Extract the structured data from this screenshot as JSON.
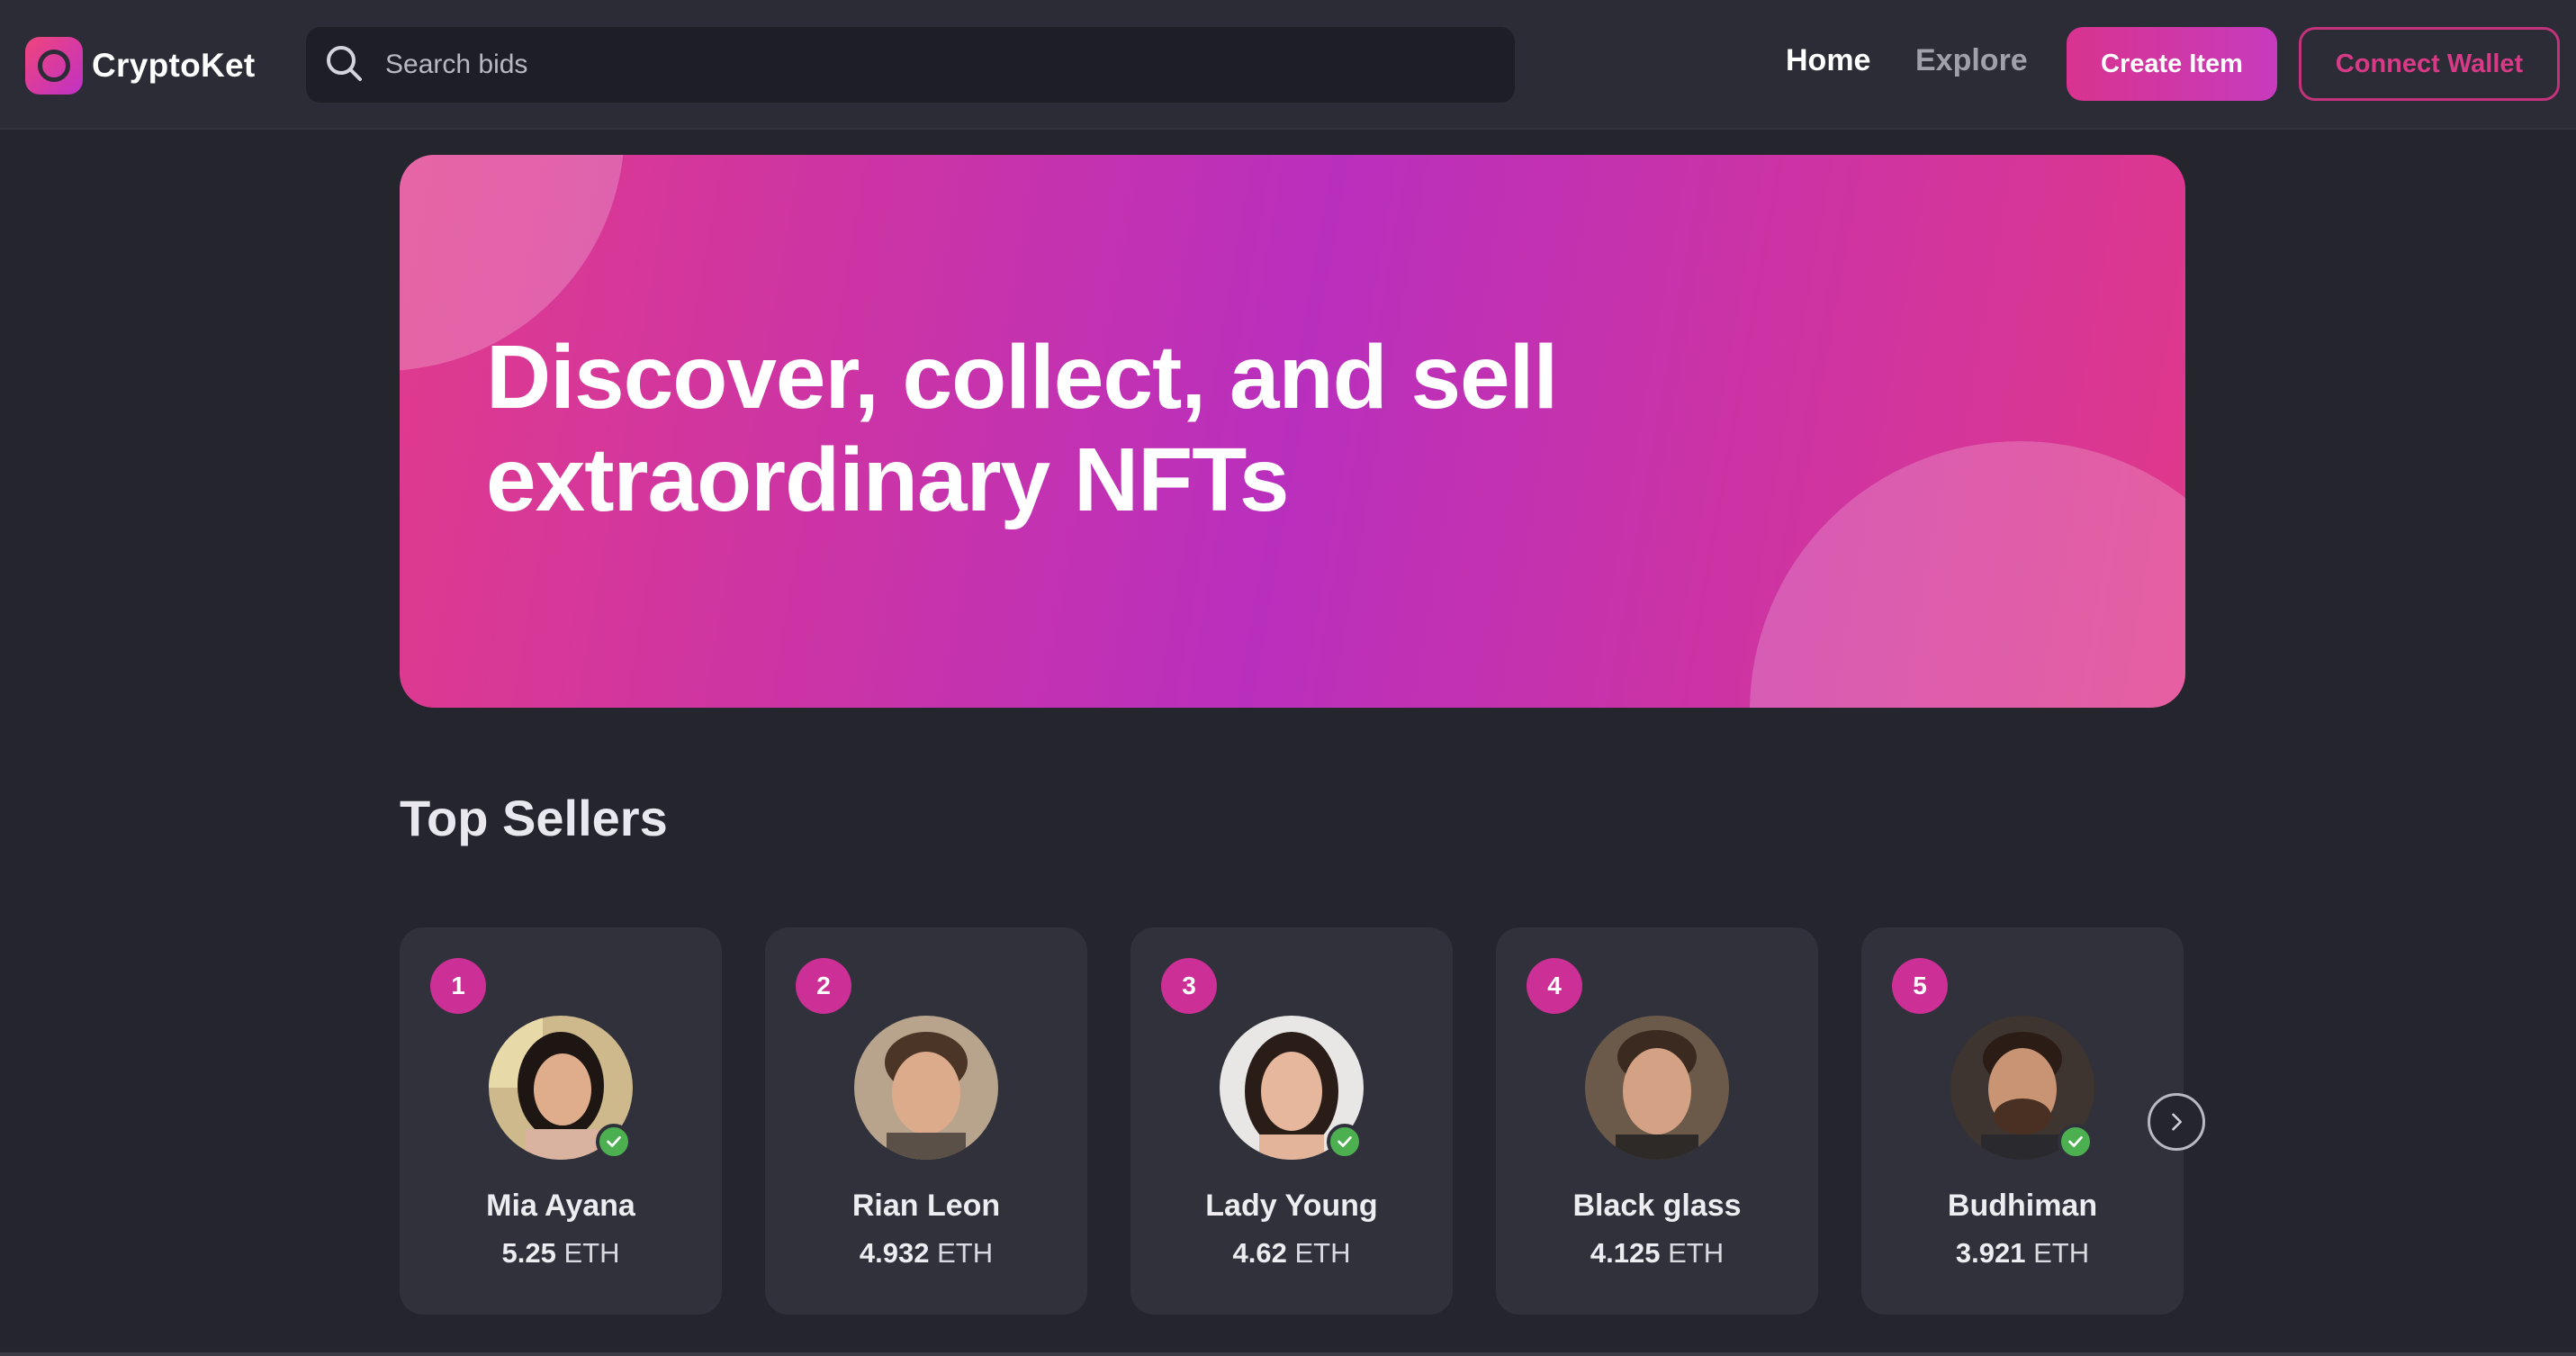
{
  "brand": {
    "name": "CryptoKet",
    "logo_icon": "ring-logo-icon",
    "gradient_from": "#f0457b",
    "gradient_to": "#c031c6"
  },
  "search": {
    "placeholder": "Search bids",
    "value": "",
    "icon": "search-icon"
  },
  "nav": {
    "home_label": "Home",
    "explore_label": "Explore",
    "active": "Home"
  },
  "actions": {
    "create_label": "Create Item",
    "connect_label": "Connect Wallet",
    "accent": "#d8338f"
  },
  "hero": {
    "title_line1": "Discover, collect, and sell",
    "title_line2": "extraordinary NFTs"
  },
  "top_sellers": {
    "title": "Top Sellers",
    "currency": "ETH",
    "sellers": [
      {
        "rank": "1",
        "name": "Mia Ayana",
        "amount": "5.25",
        "currency": "ETH",
        "verified": true
      },
      {
        "rank": "2",
        "name": "Rian Leon",
        "amount": "4.932",
        "currency": "ETH",
        "verified": false
      },
      {
        "rank": "3",
        "name": "Lady Young",
        "amount": "4.62",
        "currency": "ETH",
        "verified": true
      },
      {
        "rank": "4",
        "name": "Black glass",
        "amount": "4.125",
        "currency": "ETH",
        "verified": false
      },
      {
        "rank": "5",
        "name": "Budhiman",
        "amount": "3.921",
        "currency": "ETH",
        "verified": true
      }
    ],
    "next_icon": "chevron-right-icon"
  },
  "colors": {
    "background": "#24252d",
    "navbar": "#2b2c35",
    "card": "#30313b",
    "rank_badge": "#cc2f95",
    "verified": "#4caf50"
  }
}
